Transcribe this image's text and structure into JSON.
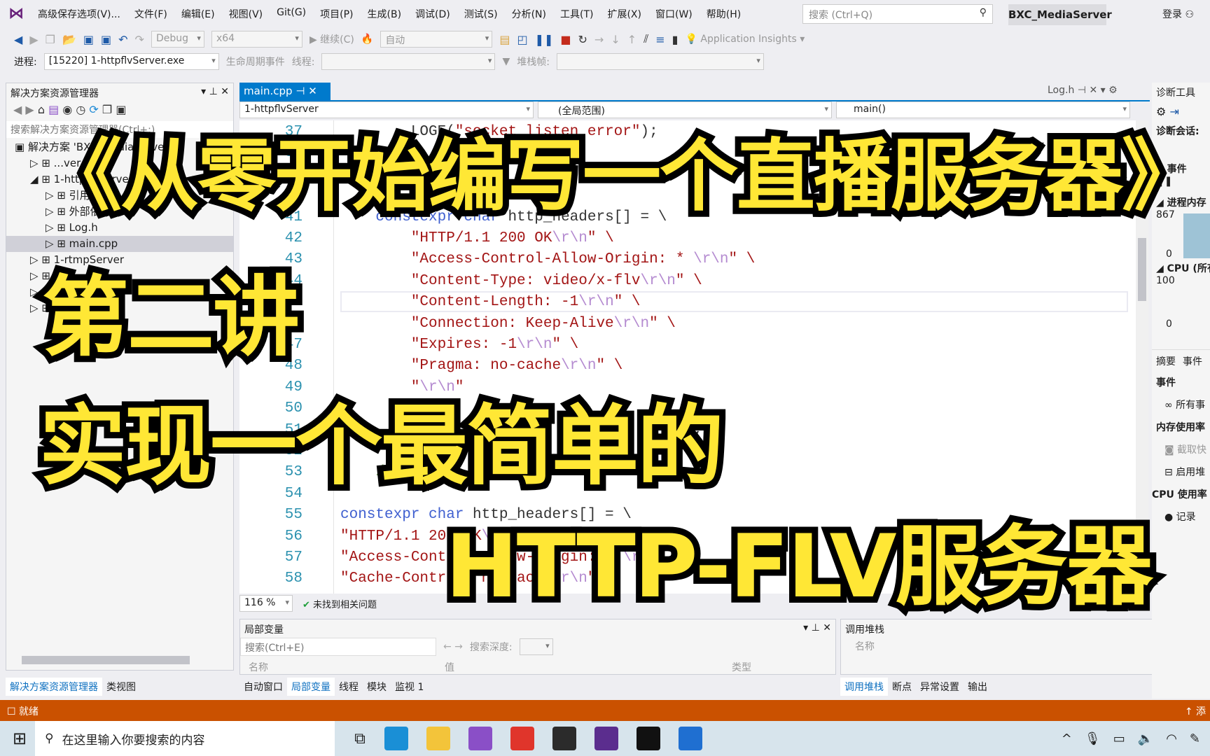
{
  "menu": {
    "items": [
      "高级保存选项(V)...",
      "文件(F)",
      "编辑(E)",
      "视图(V)",
      "Git(G)",
      "项目(P)",
      "生成(B)",
      "调试(D)",
      "测试(S)",
      "分析(N)",
      "工具(T)",
      "扩展(X)",
      "窗口(W)",
      "帮助(H)"
    ],
    "search_placeholder": "搜索 (Ctrl+Q)",
    "project": "BXC_MediaServer",
    "login": "登录"
  },
  "toolbar": {
    "config": "Debug",
    "platform": "x64",
    "continue": "继续(C)",
    "auto": "自动",
    "insights": "Application Insights",
    "process_label": "进程:",
    "process": "[15220] 1-httpflvServer.exe",
    "lifecycle": "生命周期事件",
    "thread_label": "线程:",
    "stack_label": "堆栈帧:"
  },
  "solution": {
    "title": "解决方案资源管理器",
    "search_placeholder": "搜索解决方案资源管理器(Ctrl+;)",
    "items": [
      {
        "label": "解决方案 'BXC_MediaServer'",
        "level": 0,
        "exp": ""
      },
      {
        "label": "...ver",
        "level": 1,
        "exp": "▷"
      },
      {
        "label": "1-httpflvServer",
        "level": 1,
        "exp": "◢"
      },
      {
        "label": "引用",
        "level": 2,
        "exp": "▷"
      },
      {
        "label": "外部依赖项",
        "level": 2,
        "exp": "▷"
      },
      {
        "label": "Log.h",
        "level": 2,
        "exp": "▷"
      },
      {
        "label": "main.cpp",
        "level": 2,
        "exp": "▷",
        "selected": true
      },
      {
        "label": "1-rtmpServer",
        "level": 1,
        "exp": "▷"
      },
      {
        "label": "",
        "level": 1,
        "exp": "▷"
      },
      {
        "label": "",
        "level": 1,
        "exp": "▷"
      },
      {
        "label": "",
        "level": 1,
        "exp": "▷"
      }
    ],
    "tabs": [
      "解决方案资源管理器",
      "类视图"
    ]
  },
  "editor": {
    "tab": "main.cpp",
    "right_tab": "Log.h",
    "nav": [
      "1-httpflvServer",
      "(全局范围)",
      "main()"
    ],
    "zoom": "116 %",
    "issues": "未找到相关问题",
    "lines": [
      {
        "n": "37",
        "t": [
          [
            "        LOGE(",
            "p"
          ],
          [
            "\"socket listen error\"",
            "s"
          ],
          [
            ");",
            "p"
          ]
        ]
      },
      {
        "n": "38",
        "t": []
      },
      {
        "n": "39",
        "t": []
      },
      {
        "n": "40",
        "t": []
      },
      {
        "n": "41",
        "t": [
          [
            "    constexpr char ",
            "k"
          ],
          [
            "http_headers[] = \\",
            "p"
          ]
        ]
      },
      {
        "n": "42",
        "t": [
          [
            "        \"HTTP/1.1 200 OK",
            "s"
          ],
          [
            "\\r\\n",
            "e"
          ],
          [
            "\" \\",
            "s"
          ]
        ]
      },
      {
        "n": "43",
        "t": [
          [
            "        \"Access-Control-Allow-Origin: * ",
            "s"
          ],
          [
            "\\r\\n",
            "e"
          ],
          [
            "\" \\",
            "s"
          ]
        ]
      },
      {
        "n": "44",
        "t": [
          [
            "        \"Content-Type: video/x-flv",
            "s"
          ],
          [
            "\\r\\n",
            "e"
          ],
          [
            "\" \\",
            "s"
          ]
        ]
      },
      {
        "n": "45",
        "t": [
          [
            "        \"Content-Length: -1",
            "s"
          ],
          [
            "\\r\\n",
            "e"
          ],
          [
            "\" \\",
            "s"
          ]
        ]
      },
      {
        "n": "46",
        "t": [
          [
            "        \"Connection: Keep-Alive",
            "s"
          ],
          [
            "\\r\\n",
            "e"
          ],
          [
            "\" \\",
            "s"
          ]
        ]
      },
      {
        "n": "47",
        "t": [
          [
            "        \"Expires: -1",
            "s"
          ],
          [
            "\\r\\n",
            "e"
          ],
          [
            "\" \\",
            "s"
          ]
        ]
      },
      {
        "n": "48",
        "t": [
          [
            "        \"Pragma: no-cache",
            "s"
          ],
          [
            "\\r\\n",
            "e"
          ],
          [
            "\" \\",
            "s"
          ]
        ]
      },
      {
        "n": "49",
        "t": [
          [
            "        \"",
            "s"
          ],
          [
            "\\r\\n",
            "e"
          ],
          [
            "\"",
            "s"
          ]
        ]
      },
      {
        "n": "50",
        "t": []
      },
      {
        "n": "51",
        "t": [
          [
            "                                       );",
            "p"
          ]
        ]
      },
      {
        "n": "52",
        "t": []
      },
      {
        "n": "53",
        "t": [
          [
            "    /*",
            "c"
          ]
        ]
      },
      {
        "n": "54",
        "t": []
      },
      {
        "n": "55",
        "t": [
          [
            "constexpr char ",
            "k"
          ],
          [
            "http_headers[] = \\",
            "p"
          ]
        ]
      },
      {
        "n": "56",
        "t": [
          [
            "\"HTTP/1.1 200 OK",
            "s"
          ],
          [
            "\\r\\n",
            "e"
          ],
          [
            "\" \\",
            "s"
          ]
        ]
      },
      {
        "n": "57",
        "t": [
          [
            "\"Access-Control-Allow-Origin: * ",
            "s"
          ],
          [
            "\\r\\n",
            "e"
          ],
          [
            "\" \\",
            "s"
          ]
        ]
      },
      {
        "n": "58",
        "t": [
          [
            "\"Cache-Control: no-cache",
            "s"
          ],
          [
            "\\r\\n",
            "e"
          ],
          [
            "\" \\",
            "s"
          ]
        ]
      }
    ]
  },
  "overlay": {
    "title": "《从零开始编写一个直播服务器》",
    "lecture": "第二讲",
    "line1": "实现一个最简单的",
    "line2": "HTTP-FLV服务器"
  },
  "locals": {
    "title": "局部变量",
    "search_placeholder": "搜索(Ctrl+E)",
    "depth_label": "搜索深度:",
    "cols": [
      "名称",
      "值",
      "类型"
    ],
    "tabs": [
      "自动窗口",
      "局部变量",
      "线程",
      "模块",
      "监视 1"
    ]
  },
  "callstack": {
    "title": "调用堆栈",
    "col": "名称",
    "tabs": [
      "调用堆栈",
      "断点",
      "异常设置",
      "输出"
    ]
  },
  "diag": {
    "title": "诊断工具",
    "session": "诊断会话:",
    "events": "◢ 事件",
    "mem": "◢ 进程内存",
    "mem_max": "867",
    "mem_min": "0",
    "cpu": "◢ CPU (所有",
    "cpu_max": "100",
    "cpu_min": "0",
    "tabs": [
      "摘要",
      "事件"
    ],
    "ev_head": "事件",
    "ev_all": "所有事",
    "mem_use": "内存使用率",
    "snap": "截取快",
    "heap": "启用堆",
    "cpu_use": "CPU 使用率",
    "record": "记录"
  },
  "status": {
    "text": "就绪",
    "right": "添"
  },
  "taskbar": {
    "search": "在这里输入你要搜索的内容",
    "apps": [
      {
        "name": "edge",
        "color": "#1a8fd6"
      },
      {
        "name": "explorer",
        "color": "#f3c43a"
      },
      {
        "name": "visual-studio",
        "color": "#8a4fc7"
      },
      {
        "name": "wps",
        "color": "#e0352b"
      },
      {
        "name": "obs",
        "color": "#2b2b2b"
      },
      {
        "name": "vs-console",
        "color": "#5b2d8e"
      },
      {
        "name": "terminal",
        "color": "#111111"
      },
      {
        "name": "wireshark",
        "color": "#1f6fd1"
      }
    ]
  },
  "colors": {
    "accent": "#007acc",
    "status": "#ca5100",
    "overlay_text": "#ffe735"
  }
}
